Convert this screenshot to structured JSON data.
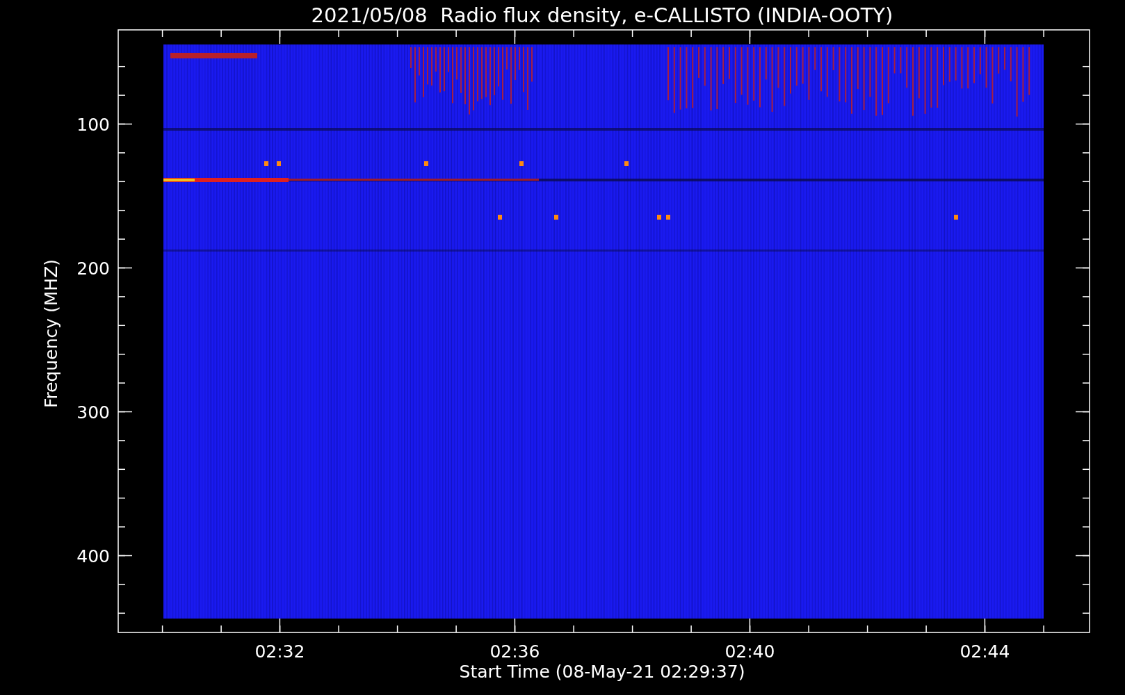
{
  "title": "2021/05/08  Radio flux density, e-CALLISTO (INDIA-OOTY)",
  "y_axis": {
    "label": "Frequency (MHZ)",
    "ticks": [
      "100",
      "200",
      "300",
      "400"
    ]
  },
  "x_axis": {
    "label": "Start Time (08-May-21 02:29:37)",
    "ticks": [
      "02:32",
      "02:36",
      "02:40",
      "02:44"
    ]
  }
}
